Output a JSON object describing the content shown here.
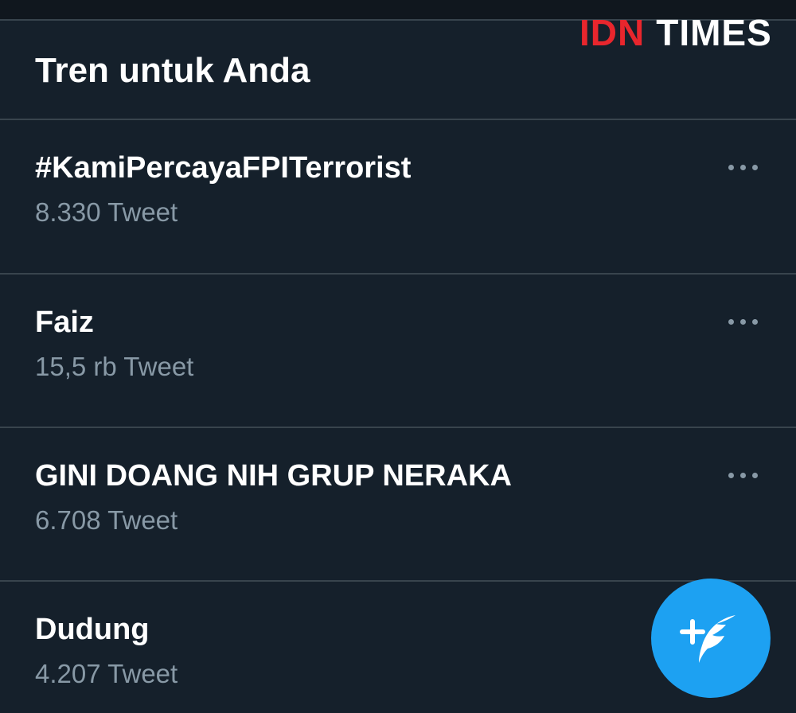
{
  "watermark": {
    "part1": "IDN",
    "part2": "TIMES",
    "part1_color": "#e8262d",
    "part2_color": "#ffffff"
  },
  "section": {
    "title": "Tren untuk Anda"
  },
  "trends": [
    {
      "name": "#KamiPercayaFPITerrorist",
      "count": "8.330 Tweet"
    },
    {
      "name": "Faiz",
      "count": "15,5 rb Tweet"
    },
    {
      "name": "GINI DOANG NIH GRUP NERAKA",
      "count": "6.708 Tweet"
    },
    {
      "name": "Dudung",
      "count": "4.207 Tweet"
    }
  ],
  "icons": {
    "more": "more-dots-icon",
    "compose": "compose-tweet-icon"
  },
  "colors": {
    "background": "#15202b",
    "text_primary": "#ffffff",
    "text_secondary": "#8899a6",
    "divider": "#38444d",
    "accent": "#1da1f2"
  }
}
